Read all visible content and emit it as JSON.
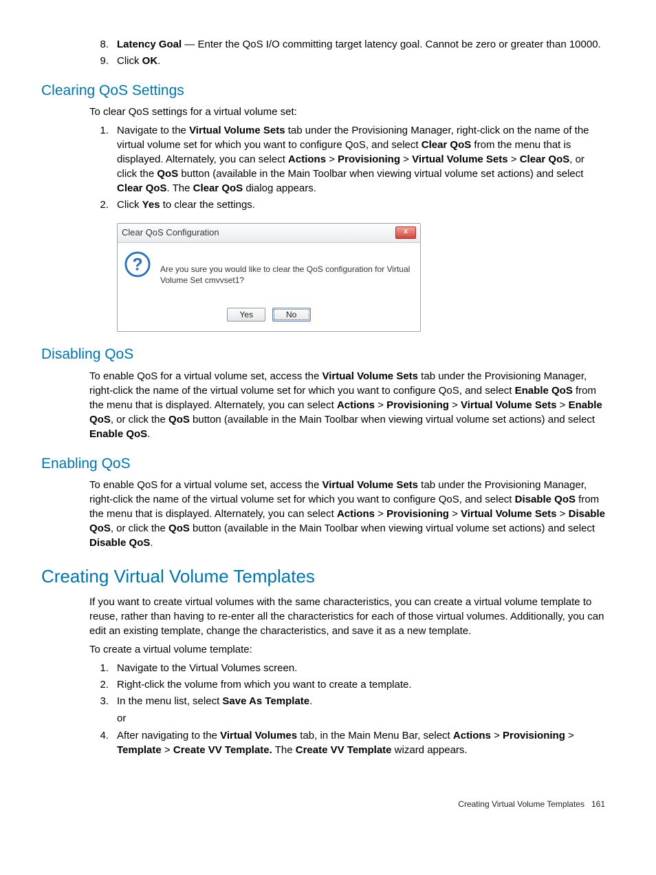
{
  "top_list": {
    "item8_num": "8.",
    "item8_label": "Latency Goal",
    "item8_rest": " — Enter the QoS I/O committing target latency goal. Cannot be zero or greater than 10000.",
    "item9_num": "9.",
    "item9_pre": "Click ",
    "item9_bold": "OK",
    "item9_post": "."
  },
  "clearing": {
    "heading": "Clearing QoS Settings",
    "intro": "To clear QoS settings for a virtual volume set:",
    "i1_num": "1.",
    "i1_a": "Navigate to the ",
    "i1_b1": "Virtual Volume Sets",
    "i1_c": " tab under the Provisioning Manager, right-click on the name of the virtual volume set for which you want to configure QoS, and select ",
    "i1_b2": "Clear QoS",
    "i1_d": " from the menu that is displayed. Alternately, you can select ",
    "i1_b3": "Actions",
    "i1_gt1": " > ",
    "i1_b4": "Provisioning",
    "i1_gt2": " > ",
    "i1_b5": "Virtual Volume Sets",
    "i1_gt3": " > ",
    "i1_b6": "Clear QoS",
    "i1_e": ", or click the ",
    "i1_b7": "QoS",
    "i1_f": " button (available in the Main Toolbar when viewing virtual volume set actions) and select ",
    "i1_b8": "Clear QoS",
    "i1_g": ". The ",
    "i1_b9": "Clear QoS",
    "i1_h": " dialog appears.",
    "i2_num": "2.",
    "i2_a": "Click ",
    "i2_b": "Yes",
    "i2_c": " to clear the settings."
  },
  "dialog": {
    "title": "Clear QoS Configuration",
    "close": "x",
    "message": "Are you sure you would like to clear the QoS configuration for Virtual Volume Set cmvvset1?",
    "yes": "Yes",
    "no": "No"
  },
  "disabling": {
    "heading": "Disabling QoS",
    "a": "To enable QoS for a virtual volume set, access the ",
    "b1": "Virtual Volume Sets",
    "c": " tab under the Provisioning Manager, right-click the name of the virtual volume set for which you want to configure QoS, and select ",
    "b2": "Enable QoS",
    "d": " from the menu that is displayed. Alternately, you can select ",
    "b3": "Actions",
    "gt1": " > ",
    "b4": "Provisioning",
    "gt2": " > ",
    "b5": "Virtual Volume Sets",
    "gt3": " > ",
    "b6": "Enable QoS",
    "e": ", or click the ",
    "b7": "QoS",
    "f": " button (available in the Main Toolbar when viewing virtual volume set actions) and select ",
    "b8": "Enable QoS",
    "g": "."
  },
  "enabling": {
    "heading": "Enabling QoS",
    "a": "To enable QoS for a virtual volume set, access the ",
    "b1": "Virtual Volume Sets",
    "c": " tab under the Provisioning Manager, right-click the name of the virtual volume set for which you want to configure QoS, and select ",
    "b2": "Disable QoS",
    "d": " from the menu that is displayed. Alternately, you can select ",
    "b3": "Actions",
    "gt1": " > ",
    "b4": "Provisioning",
    "gt2": " > ",
    "b5": "Virtual Volume Sets",
    "gt3": " > ",
    "b6": "Disable QoS",
    "e": ", or click the ",
    "b7": "QoS",
    "f": " button (available in the Main Toolbar when viewing virtual volume set actions) and select ",
    "b8": "Disable QoS",
    "g": "."
  },
  "templates": {
    "heading": "Creating Virtual Volume Templates",
    "p1": "If you want to create virtual volumes with the same characteristics, you can create a virtual volume template to reuse, rather than having to re-enter all the characteristics for each of those virtual volumes. Additionally, you can edit an existing template, change the characteristics, and save it as a new template.",
    "p2": "To create a virtual volume template:",
    "i1_num": "1.",
    "i1": "Navigate to the Virtual Volumes screen.",
    "i2_num": "2.",
    "i2": "Right-click the volume from which you want to create a template.",
    "i3_num": "3.",
    "i3_a": "In the menu list, select ",
    "i3_b": "Save As Template",
    "i3_c": ".",
    "or": "or",
    "i4_num": "4.",
    "i4_a": "After navigating to the ",
    "i4_b1": "Virtual Volumes",
    "i4_c": " tab, in the Main Menu Bar, select ",
    "i4_b2": "Actions",
    "i4_gt1": " > ",
    "i4_b3": "Provisioning",
    "i4_gt2": " > ",
    "i4_b4": "Template",
    "i4_gt3": " > ",
    "i4_b5": "Create VV Template.",
    "i4_d": " The ",
    "i4_b6": "Create VV Template",
    "i4_e": " wizard appears."
  },
  "footer": {
    "text": "Creating Virtual Volume Templates",
    "page": "161"
  }
}
